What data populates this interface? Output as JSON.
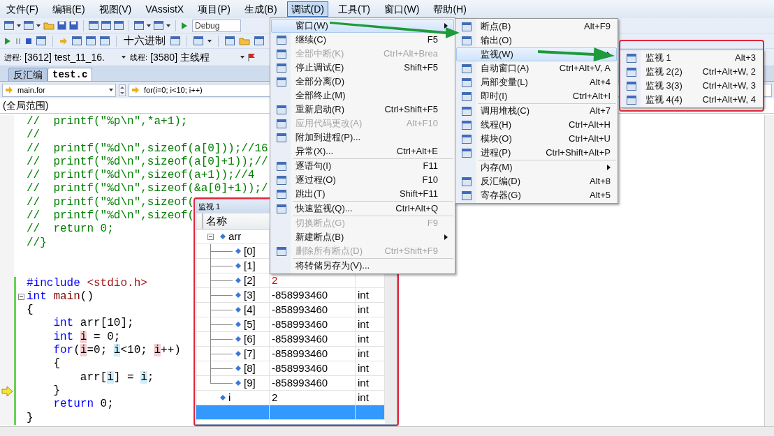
{
  "menubar": [
    {
      "label": "文件(F)",
      "selected": false
    },
    {
      "label": "编辑(E)",
      "selected": false
    },
    {
      "label": "视图(V)",
      "selected": false
    },
    {
      "label": "VAssistX",
      "selected": false
    },
    {
      "label": "项目(P)",
      "selected": false
    },
    {
      "label": "生成(B)",
      "selected": false
    },
    {
      "label": "调试(D)",
      "selected": true
    },
    {
      "label": "工具(T)",
      "selected": false
    },
    {
      "label": "窗口(W)",
      "selected": false
    },
    {
      "label": "帮助(H)",
      "selected": false
    }
  ],
  "toolbar": {
    "configuration": "Debug",
    "hex_button": "十六进制"
  },
  "debug_location": {
    "process_label": "进程:",
    "process": "[3612] test_11_16.",
    "thread_label": "线程:",
    "thread": "[3580] 主线程"
  },
  "tabs": [
    {
      "label": "反汇编",
      "selected": false
    },
    {
      "label": "test.c",
      "selected": true
    }
  ],
  "navigation": {
    "scope": "main.for",
    "member": "for(i=0; i<10; i++)",
    "context": "(全局范围)"
  },
  "code_lines": [
    {
      "segments": [
        {
          "kind": "comment",
          "text": "//  printf(\"%p\\n\",*a+1);"
        }
      ],
      "modified": false,
      "current": false
    },
    {
      "segments": [
        {
          "kind": "comment",
          "text": "//"
        }
      ],
      "modified": false,
      "current": false
    },
    {
      "segments": [
        {
          "kind": "comment",
          "text": "//  printf(\"%d\\n\",sizeof(a[0]));//16"
        }
      ],
      "modified": false,
      "current": false
    },
    {
      "segments": [
        {
          "kind": "comment",
          "text": "//  printf(\"%d\\n\",sizeof(a[0]+1));//"
        }
      ],
      "modified": false,
      "current": false
    },
    {
      "segments": [
        {
          "kind": "comment",
          "text": "//  printf(\"%d\\n\",sizeof(a+1));//4"
        }
      ],
      "modified": false,
      "current": false
    },
    {
      "segments": [
        {
          "kind": "comment",
          "text": "//  printf(\"%d\\n\",sizeof(&a[0]+1));/"
        }
      ],
      "modified": false,
      "current": false
    },
    {
      "segments": [
        {
          "kind": "comment",
          "text": "//  printf(\"%d\\n\",sizeof("
        }
      ],
      "modified": false,
      "current": false
    },
    {
      "segments": [
        {
          "kind": "comment",
          "text": "//  printf(\"%d\\n\",sizeof("
        }
      ],
      "modified": false,
      "current": false
    },
    {
      "segments": [
        {
          "kind": "comment",
          "text": "//  return 0;"
        }
      ],
      "modified": false,
      "current": false
    },
    {
      "segments": [
        {
          "kind": "comment",
          "text": "//}"
        }
      ],
      "modified": false,
      "current": false
    },
    {
      "modified": false,
      "current": false
    },
    {
      "modified": false,
      "current": false
    },
    {
      "segments": [
        {
          "kind": "keyword",
          "text": "#include"
        },
        {
          "kind": "path",
          "text": " <stdio.h>"
        }
      ],
      "modified": true,
      "current": false
    },
    {
      "segments": [
        {
          "kind": "keyword",
          "text": "int"
        },
        {
          "kind": "function",
          "text": " main"
        },
        {
          "kind": "plain",
          "text": "()"
        }
      ],
      "modified": true,
      "current": false,
      "fold_expanded": true
    },
    {
      "segments": [
        {
          "kind": "plain",
          "text": "{"
        }
      ],
      "modified": true,
      "current": false
    },
    {
      "segments": [
        {
          "kind": "keyword",
          "text": "    int"
        },
        {
          "kind": "plain",
          "text": " arr[10];"
        }
      ],
      "modified": true,
      "current": false
    },
    {
      "segments": [
        {
          "kind": "keyword",
          "text": "    int "
        },
        {
          "kind": "write",
          "text": "i"
        },
        {
          "kind": "plain",
          "text": " = 0;"
        }
      ],
      "modified": true,
      "current": false
    },
    {
      "segments": [
        {
          "kind": "keyword",
          "text": "    for"
        },
        {
          "kind": "plain",
          "text": "("
        },
        {
          "kind": "write",
          "text": "i"
        },
        {
          "kind": "plain",
          "text": "=0; "
        },
        {
          "kind": "read",
          "text": "i"
        },
        {
          "kind": "plain",
          "text": "<10; "
        },
        {
          "kind": "write",
          "text": "i"
        },
        {
          "kind": "plain",
          "text": "++)"
        }
      ],
      "modified": true,
      "current": false
    },
    {
      "segments": [
        {
          "kind": "plain",
          "text": "    {"
        }
      ],
      "modified": true,
      "current": false
    },
    {
      "segments": [
        {
          "kind": "plain",
          "text": "        arr["
        },
        {
          "kind": "read",
          "text": "i"
        },
        {
          "kind": "plain",
          "text": "] = "
        },
        {
          "kind": "read",
          "text": "i"
        },
        {
          "kind": "plain",
          "text": ";"
        }
      ],
      "modified": true,
      "current": false
    },
    {
      "segments": [
        {
          "kind": "plain",
          "text": "    }"
        }
      ],
      "modified": true,
      "current": true
    },
    {
      "segments": [
        {
          "kind": "keyword",
          "text": "    return"
        },
        {
          "kind": "plain",
          "text": " 0;"
        }
      ],
      "modified": true,
      "current": false
    },
    {
      "segments": [
        {
          "kind": "plain",
          "text": "}"
        }
      ],
      "modified": true,
      "current": false
    }
  ],
  "watch_window": {
    "title": "监视 1",
    "columns": [
      "名称"
    ],
    "rows": [
      {
        "name": "arr",
        "expanded": true,
        "selected": false,
        "children": [
          {
            "name": "[0]",
            "selected": false
          },
          {
            "name": "[1]",
            "selected": false
          },
          {
            "name": "[2]",
            "value": "2",
            "changed": true,
            "selected": false
          },
          {
            "name": "[3]",
            "value": "-858993460",
            "type": "int",
            "changed": false,
            "selected": false
          },
          {
            "name": "[4]",
            "value": "-858993460",
            "type": "int",
            "changed": false,
            "selected": false
          },
          {
            "name": "[5]",
            "value": "-858993460",
            "type": "int",
            "changed": false,
            "selected": false
          },
          {
            "name": "[6]",
            "value": "-858993460",
            "type": "int",
            "changed": false,
            "selected": false
          },
          {
            "name": "[7]",
            "value": "-858993460",
            "type": "int",
            "changed": false,
            "selected": false
          },
          {
            "name": "[8]",
            "value": "-858993460",
            "type": "int",
            "changed": false,
            "selected": false
          },
          {
            "name": "[9]",
            "value": "-858993460",
            "type": "int",
            "changed": false,
            "selected": false
          }
        ]
      },
      {
        "name": "i",
        "value": "2",
        "type": "int",
        "changed": false,
        "selected": false
      },
      {
        "selected": true
      }
    ]
  },
  "debug_menu": {
    "sections": [
      [
        {
          "label": "窗口(W)",
          "highlighted": true,
          "disabled": false,
          "submenu": true,
          "icon": false
        },
        {
          "label": "继续(C)",
          "shortcut": "F5",
          "highlighted": false,
          "disabled": false,
          "submenu": false,
          "icon": true
        },
        {
          "label": "全部中断(K)",
          "shortcut": "Ctrl+Alt+Brea",
          "highlighted": false,
          "disabled": true,
          "submenu": false,
          "icon": true
        },
        {
          "label": "停止调试(E)",
          "shortcut": "Shift+F5",
          "highlighted": false,
          "disabled": false,
          "submenu": false,
          "icon": true
        },
        {
          "label": "全部分离(D)",
          "highlighted": false,
          "disabled": false,
          "submenu": false,
          "icon": true
        },
        {
          "label": "全部终止(M)",
          "highlighted": false,
          "disabled": false,
          "submenu": false,
          "icon": false
        },
        {
          "label": "重新启动(R)",
          "shortcut": "Ctrl+Shift+F5",
          "highlighted": false,
          "disabled": false,
          "submenu": false,
          "icon": true
        },
        {
          "label": "应用代码更改(A)",
          "shortcut": "Alt+F10",
          "highlighted": false,
          "disabled": true,
          "submenu": false,
          "icon": true
        },
        {
          "label": "附加到进程(P)...",
          "highlighted": false,
          "disabled": false,
          "submenu": false,
          "icon": true
        },
        {
          "label": "异常(X)...",
          "shortcut": "Ctrl+Alt+E",
          "highlighted": false,
          "disabled": false,
          "submenu": false,
          "icon": false
        }
      ],
      [
        {
          "label": "逐语句(I)",
          "shortcut": "F11",
          "highlighted": false,
          "disabled": false,
          "submenu": false,
          "icon": true
        },
        {
          "label": "逐过程(O)",
          "shortcut": "F10",
          "highlighted": false,
          "disabled": false,
          "submenu": false,
          "icon": true
        },
        {
          "label": "跳出(T)",
          "shortcut": "Shift+F11",
          "highlighted": false,
          "disabled": false,
          "submenu": false,
          "icon": true
        }
      ],
      [
        {
          "label": "快速监视(Q)...",
          "shortcut": "Ctrl+Alt+Q",
          "highlighted": false,
          "disabled": false,
          "submenu": false,
          "icon": true
        }
      ],
      [
        {
          "label": "切换断点(G)",
          "shortcut": "F9",
          "highlighted": false,
          "disabled": true,
          "submenu": false,
          "icon": false
        },
        {
          "label": "新建断点(B)",
          "highlighted": false,
          "disabled": false,
          "submenu": true,
          "icon": false
        },
        {
          "label": "删除所有断点(D)",
          "shortcut": "Ctrl+Shift+F9",
          "highlighted": false,
          "disabled": true,
          "submenu": false,
          "icon": true
        }
      ],
      [
        {
          "label": "将转储另存为(V)...",
          "highlighted": false,
          "disabled": false,
          "submenu": false,
          "icon": false
        }
      ]
    ]
  },
  "window_submenu": {
    "sections": [
      [
        {
          "label": "断点(B)",
          "shortcut": "Alt+F9",
          "highlighted": false,
          "disabled": false,
          "submenu": false,
          "icon": true
        },
        {
          "label": "输出(O)",
          "highlighted": false,
          "disabled": false,
          "submenu": false,
          "icon": true
        },
        {
          "label": "监视(W)",
          "highlighted": true,
          "disabled": false,
          "submenu": true,
          "icon": false
        },
        {
          "label": "自动窗口(A)",
          "shortcut": "Ctrl+Alt+V, A",
          "highlighted": false,
          "disabled": false,
          "submenu": false,
          "icon": true
        },
        {
          "label": "局部变量(L)",
          "shortcut": "Alt+4",
          "highlighted": false,
          "disabled": false,
          "submenu": false,
          "icon": true
        },
        {
          "label": "即时(I)",
          "shortcut": "Ctrl+Alt+I",
          "highlighted": false,
          "disabled": false,
          "submenu": false,
          "icon": true
        }
      ],
      [
        {
          "label": "调用堆栈(C)",
          "shortcut": "Alt+7",
          "highlighted": false,
          "disabled": false,
          "submenu": false,
          "icon": true
        },
        {
          "label": "线程(H)",
          "shortcut": "Ctrl+Alt+H",
          "highlighted": false,
          "disabled": false,
          "submenu": false,
          "icon": true
        },
        {
          "label": "模块(O)",
          "shortcut": "Ctrl+Alt+U",
          "highlighted": false,
          "disabled": false,
          "submenu": false,
          "icon": true
        },
        {
          "label": "进程(P)",
          "shortcut": "Ctrl+Shift+Alt+P",
          "highlighted": false,
          "disabled": false,
          "submenu": false,
          "icon": true
        }
      ],
      [
        {
          "label": "内存(M)",
          "highlighted": false,
          "disabled": false,
          "submenu": true,
          "icon": false
        },
        {
          "label": "反汇编(D)",
          "shortcut": "Alt+8",
          "highlighted": false,
          "disabled": false,
          "submenu": false,
          "icon": true
        },
        {
          "label": "寄存器(G)",
          "shortcut": "Alt+5",
          "highlighted": false,
          "disabled": false,
          "submenu": false,
          "icon": true
        }
      ]
    ]
  },
  "watch_submenu": {
    "sections": [
      [
        {
          "label": "监视 1",
          "shortcut": "Alt+3",
          "highlighted": false,
          "disabled": false,
          "submenu": false,
          "icon": true
        },
        {
          "label": "监视 2(2)",
          "shortcut": "Ctrl+Alt+W, 2",
          "highlighted": false,
          "disabled": false,
          "submenu": false,
          "icon": true
        },
        {
          "label": "监视 3(3)",
          "shortcut": "Ctrl+Alt+W, 3",
          "highlighted": false,
          "disabled": false,
          "submenu": false,
          "icon": true
        },
        {
          "label": "监视 4(4)",
          "shortcut": "Ctrl+Alt+W, 4",
          "highlighted": false,
          "disabled": false,
          "submenu": false,
          "icon": true
        }
      ]
    ]
  }
}
